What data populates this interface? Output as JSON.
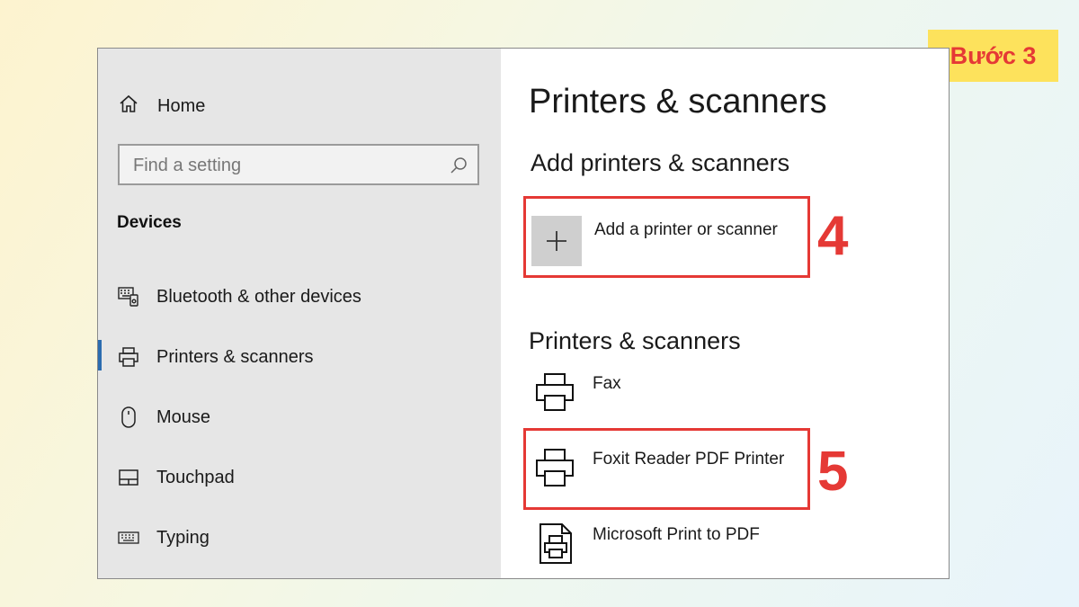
{
  "badge": {
    "text": "Bước 3"
  },
  "sidebar": {
    "home_label": "Home",
    "search_placeholder": "Find a setting",
    "section_title": "Devices",
    "items": [
      {
        "label": "Bluetooth & other devices",
        "icon": "bluetooth-devices-icon",
        "active": false
      },
      {
        "label": "Printers & scanners",
        "icon": "printer-icon",
        "active": true
      },
      {
        "label": "Mouse",
        "icon": "mouse-icon",
        "active": false
      },
      {
        "label": "Touchpad",
        "icon": "touchpad-icon",
        "active": false
      },
      {
        "label": "Typing",
        "icon": "keyboard-icon",
        "active": false
      }
    ]
  },
  "main": {
    "title": "Printers & scanners",
    "add_section_title": "Add printers & scanners",
    "add_button_label": "Add a printer or scanner",
    "list_title": "Printers & scanners",
    "printers": [
      {
        "name": "Fax",
        "icon": "printer-icon"
      },
      {
        "name": "Foxit Reader PDF Printer",
        "icon": "printer-icon"
      },
      {
        "name": "Microsoft Print to PDF",
        "icon": "pdf-printer-icon"
      }
    ]
  },
  "annotations": {
    "step4": "4",
    "step5": "5"
  },
  "colors": {
    "highlight": "#e53935",
    "badge_bg": "#fde25c",
    "accent": "#2b6cb0",
    "sidebar_bg": "#e6e6e6"
  }
}
